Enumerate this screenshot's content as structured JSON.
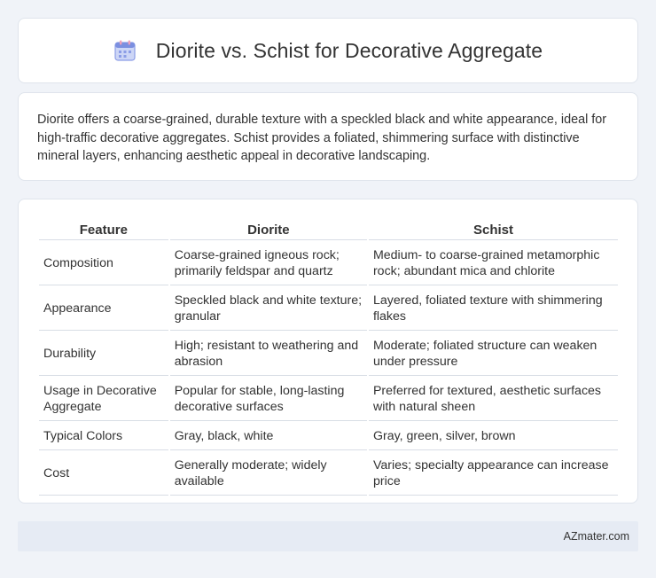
{
  "header": {
    "title": "Diorite vs. Schist for Decorative Aggregate",
    "icon": "calendar-icon"
  },
  "summary": {
    "text": "Diorite offers a coarse-grained, durable texture with a speckled black and white appearance, ideal for high-traffic decorative aggregates. Schist provides a foliated, shimmering surface with distinctive mineral layers, enhancing aesthetic appeal in decorative landscaping."
  },
  "table": {
    "headers": [
      "Feature",
      "Diorite",
      "Schist"
    ],
    "rows": [
      [
        "Composition",
        "Coarse-grained igneous rock; primarily feldspar and quartz",
        "Medium- to coarse-grained metamorphic rock; abundant mica and chlorite"
      ],
      [
        "Appearance",
        "Speckled black and white texture; granular",
        "Layered, foliated texture with shimmering flakes"
      ],
      [
        "Durability",
        "High; resistant to weathering and abrasion",
        "Moderate; foliated structure can weaken under pressure"
      ],
      [
        "Usage in Decorative Aggregate",
        "Popular for stable, long-lasting decorative surfaces",
        "Preferred for textured, aesthetic surfaces with natural sheen"
      ],
      [
        "Typical Colors",
        "Gray, black, white",
        "Gray, green, silver, brown"
      ],
      [
        "Cost",
        "Generally moderate; widely available",
        "Varies; specialty appearance can increase price"
      ]
    ]
  },
  "footer": {
    "brand": "AZmater.com"
  },
  "colors": {
    "page_bg": "#f0f3f8",
    "card_bg": "#ffffff",
    "footer_bg": "#e6ebf4",
    "icon_accent": "#7b8fe0"
  }
}
